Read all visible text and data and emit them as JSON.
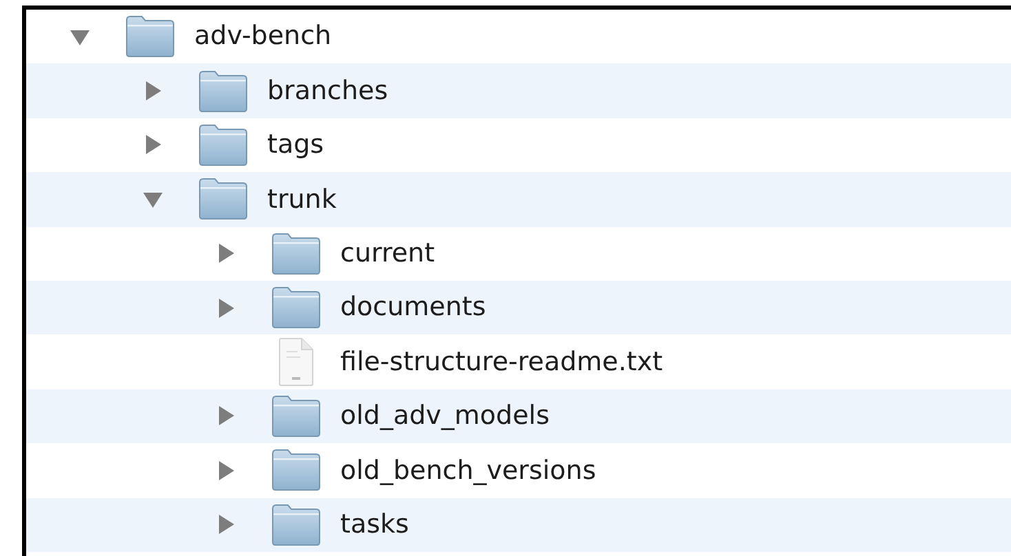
{
  "tree": [
    {
      "name": "adv-bench",
      "kind": "folder",
      "expanded": true,
      "children": [
        {
          "name": "branches",
          "kind": "folder",
          "expanded": false
        },
        {
          "name": "tags",
          "kind": "folder",
          "expanded": false
        },
        {
          "name": "trunk",
          "kind": "folder",
          "expanded": true,
          "children": [
            {
              "name": "current",
              "kind": "folder",
              "expanded": false
            },
            {
              "name": "documents",
              "kind": "folder",
              "expanded": false
            },
            {
              "name": "file-structure-readme.txt",
              "kind": "file"
            },
            {
              "name": "old_adv_models",
              "kind": "folder",
              "expanded": false
            },
            {
              "name": "old_bench_versions",
              "kind": "folder",
              "expanded": false
            },
            {
              "name": "tasks",
              "kind": "folder",
              "expanded": false
            }
          ]
        }
      ]
    }
  ]
}
